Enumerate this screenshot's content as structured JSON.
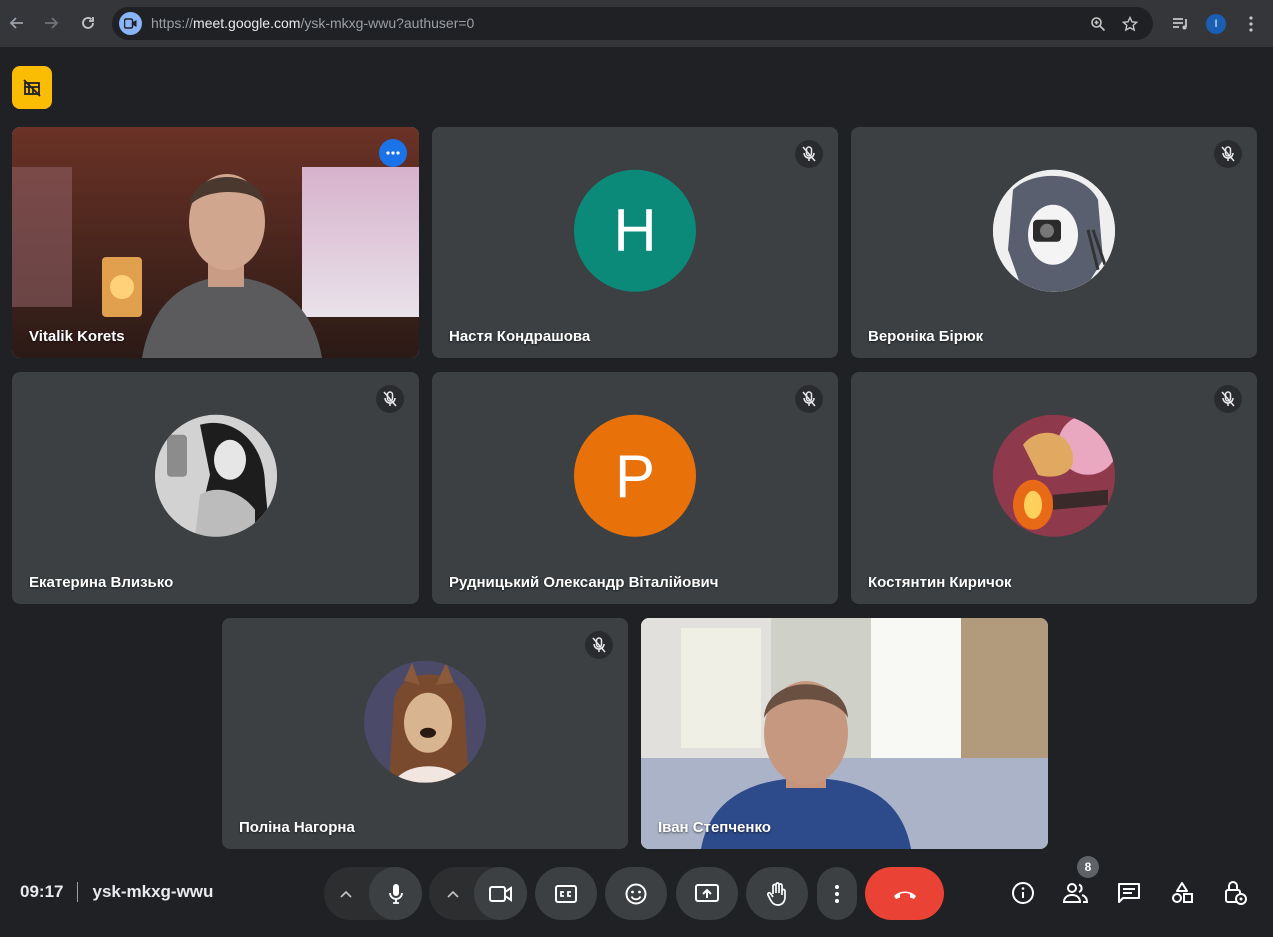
{
  "browser": {
    "url_host": "meet.google.com",
    "url_prefix": "https://",
    "url_path": "/ysk-mkxg-wwu?authuser=0",
    "profile_initial": "I"
  },
  "tiles": [
    {
      "name": "Vitalik Korets",
      "kind": "video",
      "muted": false,
      "active": true
    },
    {
      "name": "Настя Кондрашова",
      "kind": "letter",
      "letter": "H",
      "color": "#0b8a7a",
      "muted": true
    },
    {
      "name": "Вероніка Бірюк",
      "kind": "photo",
      "muted": true
    },
    {
      "name": "Екатерина Влизько",
      "kind": "photo",
      "muted": true
    },
    {
      "name": "Рудницький Олександр Віталійович",
      "kind": "letter",
      "letter": "P",
      "color": "#e8710a",
      "muted": true
    },
    {
      "name": "Костянтин Киричок",
      "kind": "photo",
      "muted": true
    },
    {
      "name": "Поліна Нагорна",
      "kind": "photo",
      "muted": true
    },
    {
      "name": "Іван Степченко",
      "kind": "video",
      "muted": false
    }
  ],
  "meeting": {
    "time": "09:17",
    "code": "ysk-mkxg-wwu",
    "participants_count": "8"
  },
  "controls": {
    "icons": [
      "mic-icon",
      "camera-icon",
      "captions-icon",
      "emoji-icon",
      "present-icon",
      "raise-hand-icon",
      "more-icon",
      "hangup-icon"
    ],
    "right_icons": [
      "info-icon",
      "people-icon",
      "chat-icon",
      "activities-icon",
      "host-controls-icon"
    ]
  },
  "colors": {
    "background": "#202124",
    "tile": "#3c4043",
    "accent": "#8ab4f8",
    "hangup": "#ea4335",
    "badge": "#fbbc04"
  }
}
